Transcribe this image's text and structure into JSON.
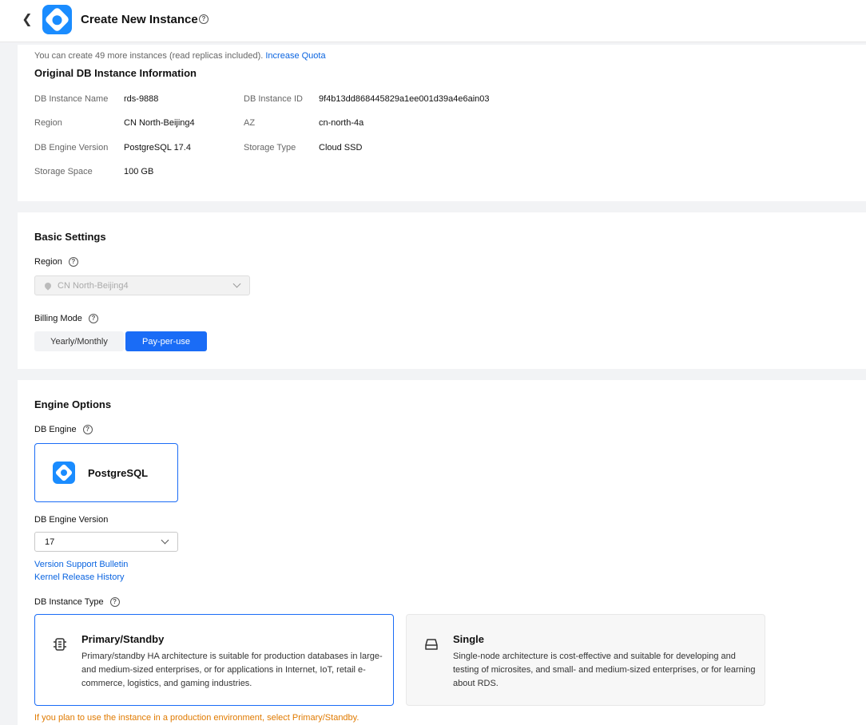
{
  "header": {
    "title": "Create New Instance"
  },
  "quota": {
    "text": "You can create 49 more instances (read replicas included).",
    "link": "Increase Quota"
  },
  "original": {
    "title": "Original DB Instance Information",
    "rows": [
      {
        "label": "DB Instance Name",
        "value": "rds-9888"
      },
      {
        "label": "DB Instance ID",
        "value": "9f4b13dd868445829a1ee001d39a4e6ain03"
      },
      {
        "label": "Region",
        "value": "CN North-Beijing4"
      },
      {
        "label": "AZ",
        "value": "cn-north-4a"
      },
      {
        "label": "DB Engine Version",
        "value": "PostgreSQL 17.4"
      },
      {
        "label": "Storage Type",
        "value": "Cloud SSD"
      },
      {
        "label": "Storage Space",
        "value": "100 GB"
      }
    ]
  },
  "basic": {
    "title": "Basic Settings",
    "region_label": "Region",
    "region_value": "CN North-Beijing4",
    "billing_label": "Billing Mode",
    "billing_options": [
      "Yearly/Monthly",
      "Pay-per-use"
    ],
    "billing_selected": "Pay-per-use"
  },
  "engine": {
    "title": "Engine Options",
    "engine_label": "DB Engine",
    "engine_name": "PostgreSQL",
    "version_label": "DB Engine Version",
    "version_value": "17",
    "links": [
      "Version Support Bulletin",
      "Kernel Release History"
    ],
    "type_label": "DB Instance Type",
    "types": [
      {
        "title": "Primary/Standby",
        "desc": "Primary/standby HA architecture is suitable for production databases in large- and medium-sized enterprises, or for applications in Internet, IoT, retail e-commerce, logistics, and gaming industries."
      },
      {
        "title": "Single",
        "desc": "Single-node architecture is cost-effective and suitable for developing and testing of microsites, and small- and medium-sized enterprises, or for learning about RDS."
      }
    ],
    "warning": "If you plan to use the instance in a production environment, select Primary/Standby."
  },
  "colors": {
    "accent": "#1a6cf6",
    "link": "#0a64e0",
    "warning": "#e07a00"
  }
}
